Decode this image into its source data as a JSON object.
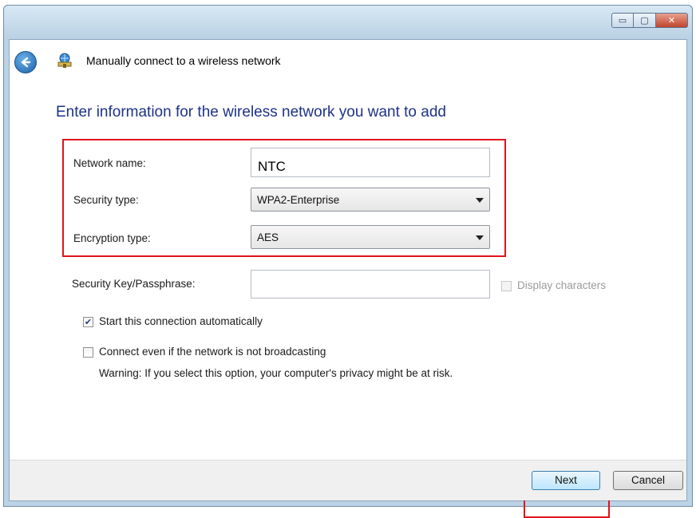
{
  "window": {
    "title": "Manually connect to a wireless network",
    "controls": {
      "minimize": "▭",
      "maximize": "▢",
      "close": "✕"
    }
  },
  "heading": "Enter information for the wireless network you want to add",
  "form": {
    "network_name": {
      "label": "Network name:",
      "value": "NTC"
    },
    "security_type": {
      "label": "Security type:",
      "value": "WPA2-Enterprise"
    },
    "encryption_type": {
      "label": "Encryption type:",
      "value": "AES"
    },
    "security_key": {
      "label": "Security Key/Passphrase:",
      "value": ""
    },
    "display_characters": {
      "label": "Display characters",
      "checked": false,
      "enabled": false
    },
    "start_automatically": {
      "label": "Start this connection automatically",
      "checked": true,
      "mark": "✔"
    },
    "connect_not_broadcasting": {
      "label": "Connect even if the network is not broadcasting",
      "checked": false,
      "warning": "Warning: If you select this option, your computer's privacy might be at risk."
    }
  },
  "buttons": {
    "next": "Next",
    "cancel": "Cancel"
  },
  "icons": {
    "back": "back-arrow-icon",
    "network": "wireless-network-icon"
  },
  "colors": {
    "highlight": "#e0141b",
    "heading": "#1e3287"
  }
}
